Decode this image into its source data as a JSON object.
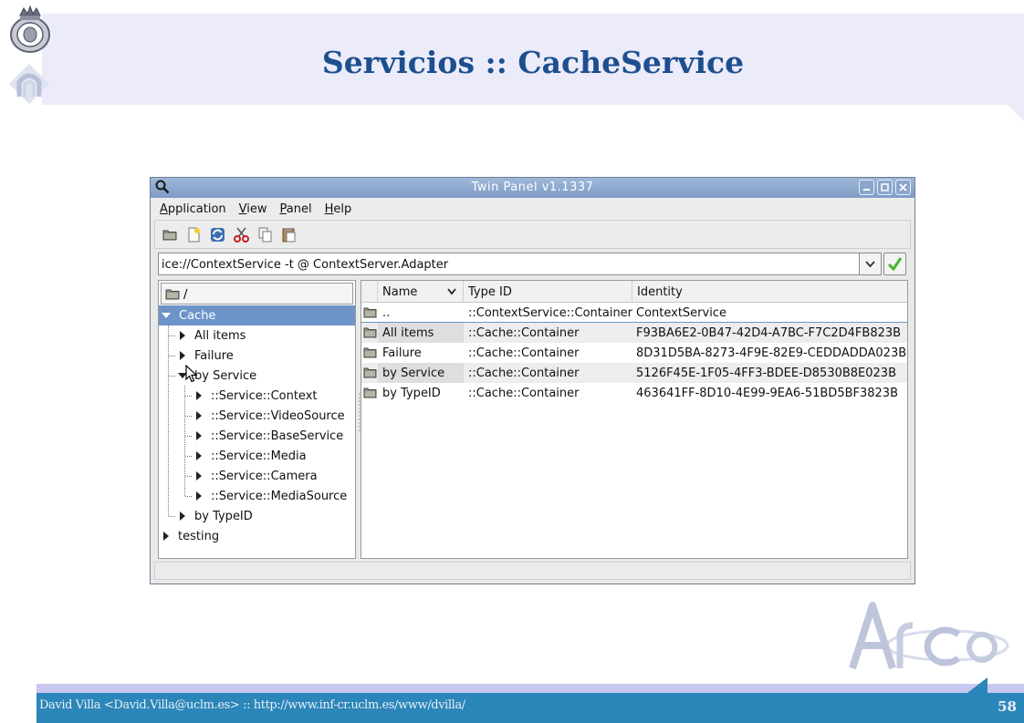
{
  "slide": {
    "title": "Servicios :: CacheService",
    "footer_text": "David Villa <David.Villa@uclm.es> :: http://www.inf-cr.uclm.es/www/dvilla/",
    "page_number": "58",
    "logo_text": "Arco"
  },
  "window": {
    "title": "Twin Panel v1.1337",
    "icon": "magnifier-icon",
    "controls": [
      "minimize-icon",
      "maximize-icon",
      "close-icon"
    ]
  },
  "menu": [
    {
      "accel": "A",
      "rest": "pplication"
    },
    {
      "accel": "V",
      "rest": "iew"
    },
    {
      "accel": "P",
      "rest": "anel"
    },
    {
      "accel": "H",
      "rest": "elp"
    }
  ],
  "toolbar": [
    "folder-icon",
    "new-file-icon",
    "refresh-icon",
    "cut-icon",
    "copy-icon",
    "paste-icon"
  ],
  "address": {
    "value": "ice://ContextService -t @ ContextServer.Adapter"
  },
  "left_pane": {
    "path": "/",
    "tree": [
      {
        "label": "Cache",
        "state": "expanded",
        "selected": true
      },
      {
        "label": "All items",
        "state": "collapsed"
      },
      {
        "label": "Failure",
        "state": "collapsed"
      },
      {
        "label": "by Service",
        "state": "expanded"
      },
      {
        "label": "::Service::Context",
        "state": "collapsed"
      },
      {
        "label": "::Service::VideoSource",
        "state": "collapsed"
      },
      {
        "label": "::Service::BaseService",
        "state": "collapsed"
      },
      {
        "label": "::Service::Media",
        "state": "collapsed"
      },
      {
        "label": "::Service::Camera",
        "state": "collapsed"
      },
      {
        "label": "::Service::MediaSource",
        "state": "collapsed"
      },
      {
        "label": "by TypeID",
        "state": "collapsed"
      },
      {
        "label": "testing",
        "state": "collapsed"
      }
    ]
  },
  "right_pane": {
    "columns": [
      "Name",
      "Type ID",
      "Identity"
    ],
    "rows": [
      {
        "name": "..",
        "type_id": "::ContextService::Container",
        "identity": "ContextService"
      },
      {
        "name": "All items",
        "type_id": "::Cache::Container",
        "identity": "F93BA6E2-0B47-42D4-A7BC-F7C2D4FB823B"
      },
      {
        "name": "Failure",
        "type_id": "::Cache::Container",
        "identity": "8D31D5BA-8273-4F9E-82E9-CEDDADDA023B"
      },
      {
        "name": "by Service",
        "type_id": "::Cache::Container",
        "identity": "5126F45E-1F05-4FF3-BDEE-D8530B8E023B"
      },
      {
        "name": "by TypeID",
        "type_id": "::Cache::Container",
        "identity": "463641FF-8D10-4E99-9EA6-51BD5BF3823B"
      }
    ]
  },
  "colors": {
    "title": "#1d4f8f",
    "header_band": "#ebebf9",
    "footer_band": "#2b86b9",
    "selection": "#6d94c9",
    "titlebar": "#8aa6cc"
  }
}
